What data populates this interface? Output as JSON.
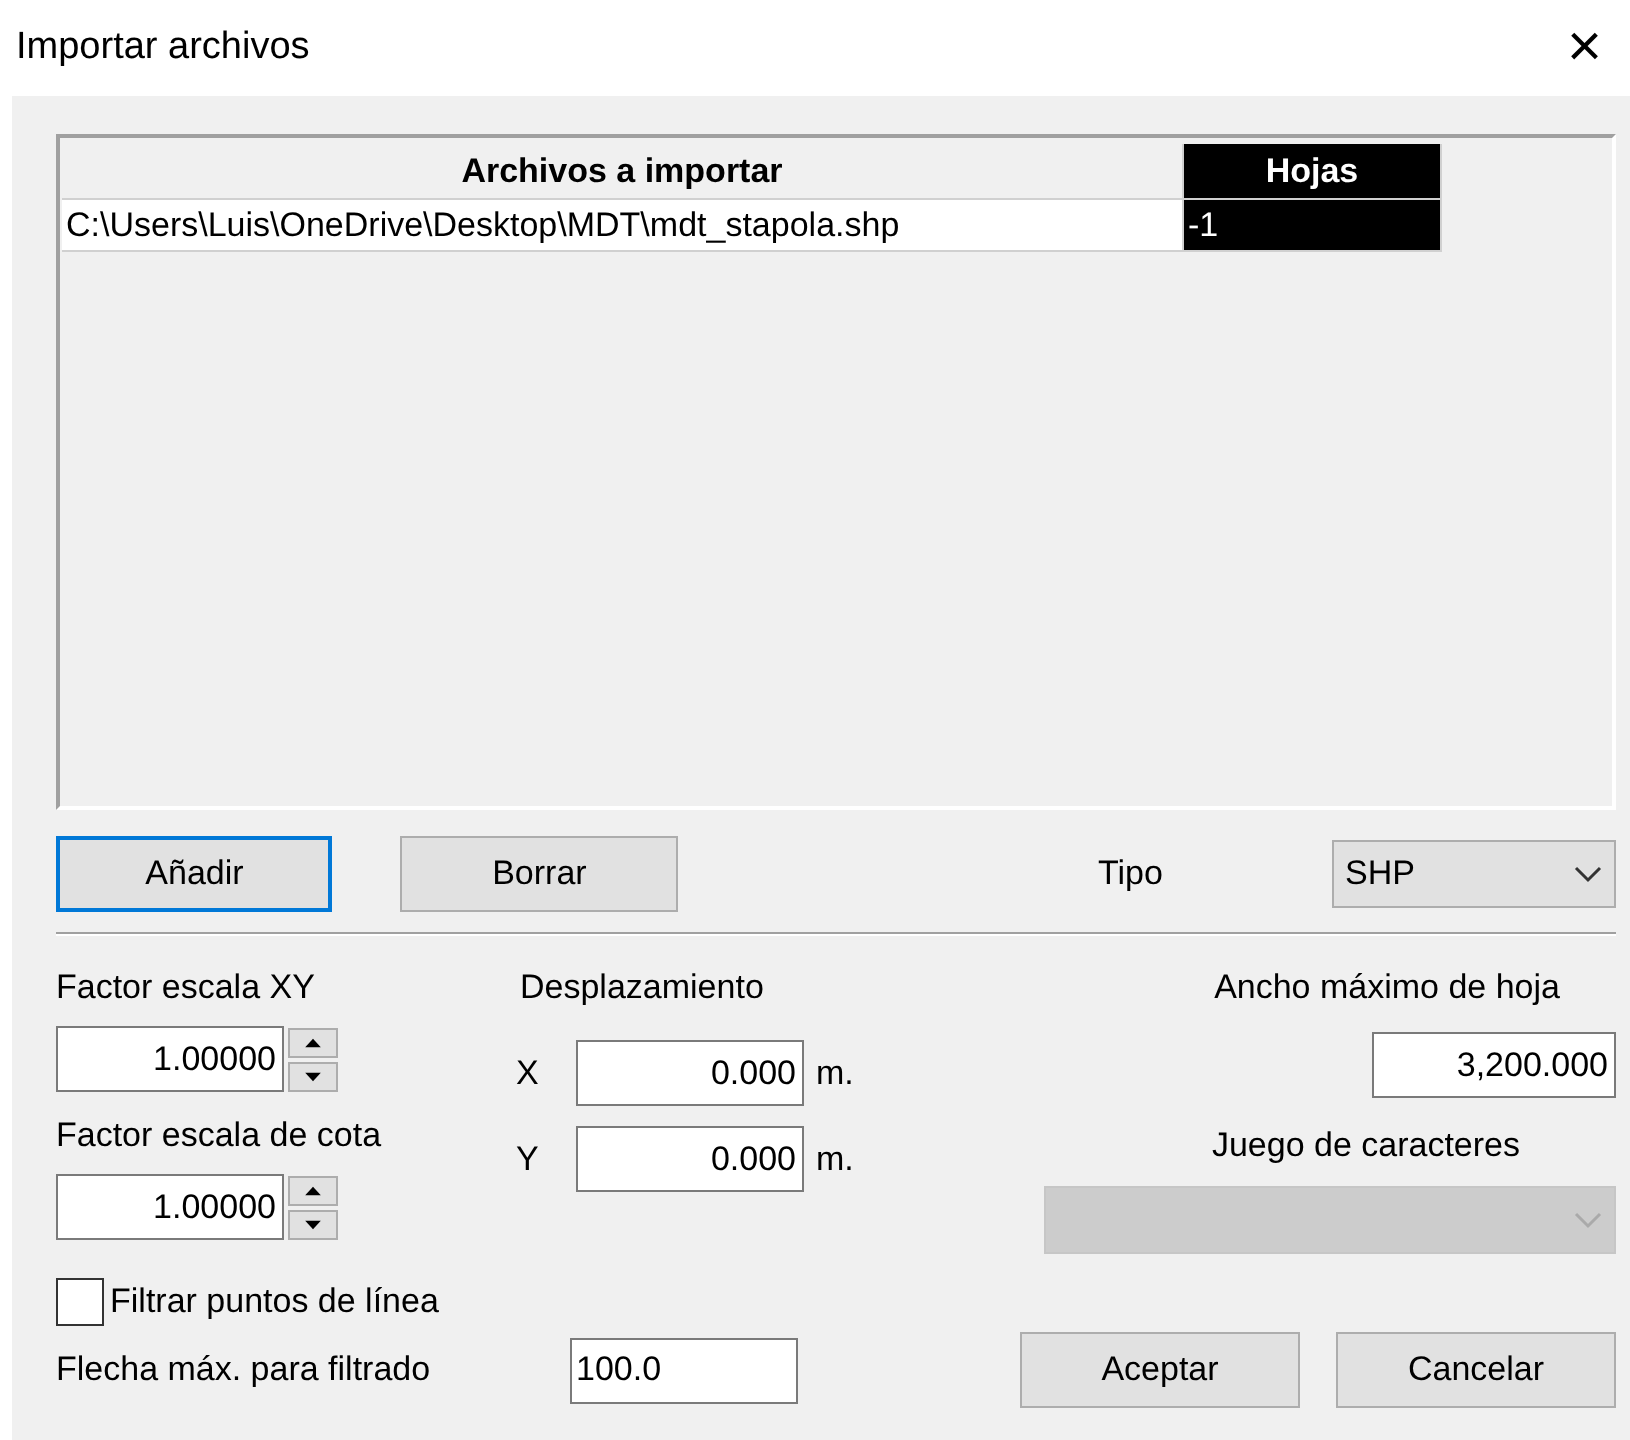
{
  "window": {
    "title": "Importar archivos",
    "close": "×"
  },
  "table": {
    "columns": [
      {
        "label": "Archivos a importar",
        "selected": false
      },
      {
        "label": "Hojas",
        "selected": true
      }
    ],
    "rows": [
      {
        "cells": [
          "C:\\Users\\Luis\\OneDrive\\Desktop\\MDT\\mdt_stapola.shp",
          "-1"
        ]
      }
    ]
  },
  "file_buttons": [
    {
      "label": "Añadir",
      "focused": true
    },
    {
      "label": "Borrar",
      "focused": false
    }
  ],
  "tipo": {
    "label": "Tipo",
    "value": "SHP"
  },
  "factor_xy": {
    "label": "Factor escala XY",
    "value": "1.00000"
  },
  "factor_cota": {
    "label": "Factor escala de cota",
    "value": "1.00000"
  },
  "desplazamiento": {
    "label": "Desplazamiento",
    "x": {
      "label": "X",
      "value": "0.000",
      "unit": "m."
    },
    "y": {
      "label": "Y",
      "value": "0.000",
      "unit": "m."
    }
  },
  "ancho": {
    "label": "Ancho máximo de hoja",
    "value": "3,200.000"
  },
  "juego": {
    "label": "Juego de caracteres",
    "disabled": true
  },
  "filtrar": {
    "label": "Filtrar puntos de línea",
    "checked": false
  },
  "flecha": {
    "label": "Flecha máx. para filtrado",
    "value": "100.0"
  },
  "buttons": [
    "Aceptar",
    "Cancelar"
  ]
}
